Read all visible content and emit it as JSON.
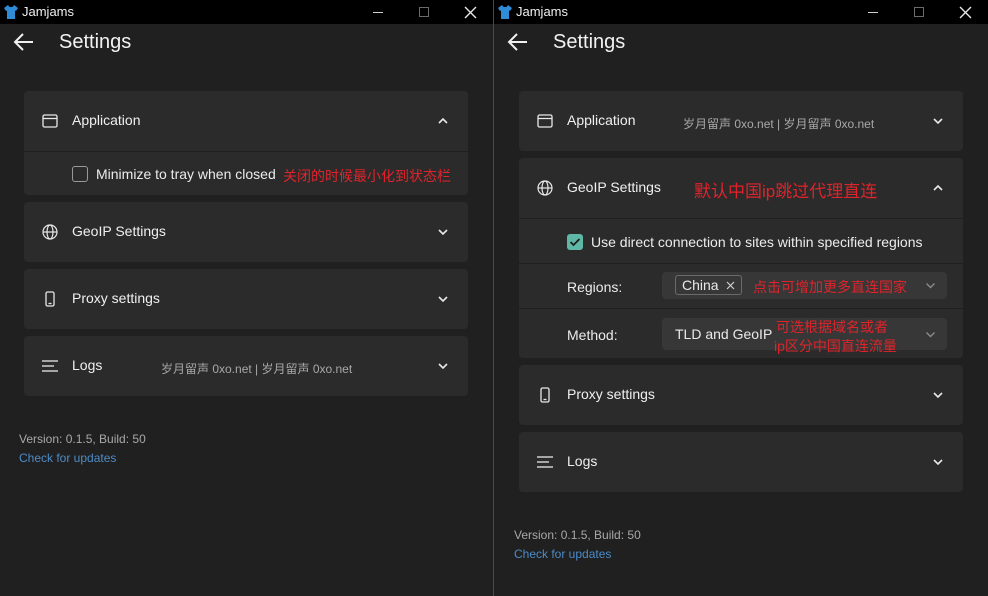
{
  "app": {
    "title": "Jamjams"
  },
  "page": {
    "title": "Settings"
  },
  "left": {
    "application": {
      "label": "Application",
      "minimize_label": "Minimize to tray when closed",
      "minimize_annotation": "关闭的时候最小化到状态栏"
    },
    "geoip": {
      "label": "GeoIP Settings"
    },
    "proxy": {
      "label": "Proxy settings"
    },
    "logs": {
      "label": "Logs",
      "description": "岁月留声 0xo.net | 岁月留声 0xo.net"
    },
    "footer": {
      "version": "Version: 0.1.5, Build: 50",
      "check_updates": "Check for updates"
    }
  },
  "right": {
    "application": {
      "label": "Application",
      "description": "岁月留声 0xo.net | 岁月留声 0xo.net"
    },
    "geoip": {
      "label": "GeoIP Settings",
      "annotation": "默认中国ip跳过代理直连",
      "direct_label": "Use direct connection to sites within specified regions",
      "regions_label": "Regions:",
      "regions_chip": "China",
      "regions_annotation": "点击可增加更多直连国家",
      "method_label": "Method:",
      "method_value": "TLD and GeoIP",
      "method_annotation_1": "可选根据域名或者",
      "method_annotation_2": "ip区分中国直连流量"
    },
    "proxy": {
      "label": "Proxy settings"
    },
    "logs": {
      "label": "Logs"
    },
    "footer": {
      "version": "Version: 0.1.5, Build: 50",
      "check_updates": "Check for updates"
    }
  },
  "colors": {
    "annotation": "#e0232b",
    "accent": "#5fb8a6",
    "link": "#4d8bc7"
  },
  "icons": [
    "app-icon",
    "minimize-icon",
    "maximize-icon",
    "close-icon",
    "back-arrow-icon",
    "window-icon",
    "globe-icon",
    "phone-icon",
    "menu-lines-icon",
    "chevron-up-icon",
    "chevron-down-icon",
    "check-icon",
    "remove-chip-icon"
  ]
}
